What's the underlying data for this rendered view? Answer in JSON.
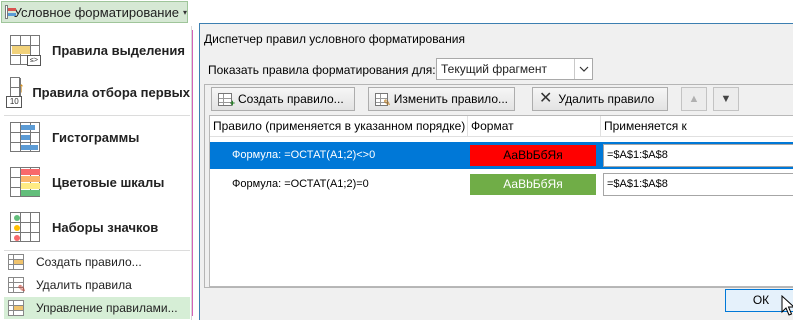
{
  "menu": {
    "button_label": "Условное форматирование",
    "caret": "▾",
    "big_items": [
      {
        "label": "Правила выделения",
        "icon": "highlight-cells-rules-icon",
        "badge": "≤>"
      },
      {
        "label": "Правила отбора первых",
        "icon": "top-bottom-rules-icon",
        "badge": "10"
      },
      {
        "label": "Гистограммы",
        "icon": "data-bars-icon"
      },
      {
        "label": "Цветовые шкалы",
        "icon": "color-scales-icon"
      },
      {
        "label": "Наборы значков",
        "icon": "icon-sets-icon"
      }
    ],
    "small_items": [
      {
        "label": "Создать правило...",
        "icon": "new-rule-icon"
      },
      {
        "label": "Удалить правила",
        "icon": "clear-rules-icon"
      },
      {
        "label": "Управление правилами...",
        "icon": "manage-rules-icon"
      }
    ]
  },
  "dialog": {
    "title": "Диспетчер правил условного форматирования",
    "show_rules_label": "Показать правила форматирования для:",
    "scope_value": "Текущий фрагмент",
    "toolbar": {
      "new_rule": "Создать правило...",
      "edit_rule": "Изменить правило...",
      "delete_rule": "Удалить правило",
      "move_up": "▲",
      "move_down": "▼"
    },
    "columns": {
      "rule": "Правило (применяется в указанном порядке)",
      "format": "Формат",
      "applies_to": "Применяется к"
    },
    "rules": [
      {
        "rule": "Формула: =ОСТАТ(A1;2)<>0",
        "format_preview": "АаВbБбЯя",
        "applies_to": "=$A$1:$A$8",
        "fill_color": "#ff0000",
        "text_color": "#000000",
        "selected": true
      },
      {
        "rule": "Формула: =ОСТАТ(A1;2)=0",
        "format_preview": "АаВbБбЯя",
        "applies_to": "=$A$1:$A$8",
        "fill_color": "#70ad47",
        "text_color": "#ffffff",
        "selected": false
      }
    ],
    "ok_label": "ОК"
  },
  "colors": {
    "accent": "#0078d7",
    "menu_button_bg": "#d6e8d4",
    "connector_line": "#d561b8"
  }
}
